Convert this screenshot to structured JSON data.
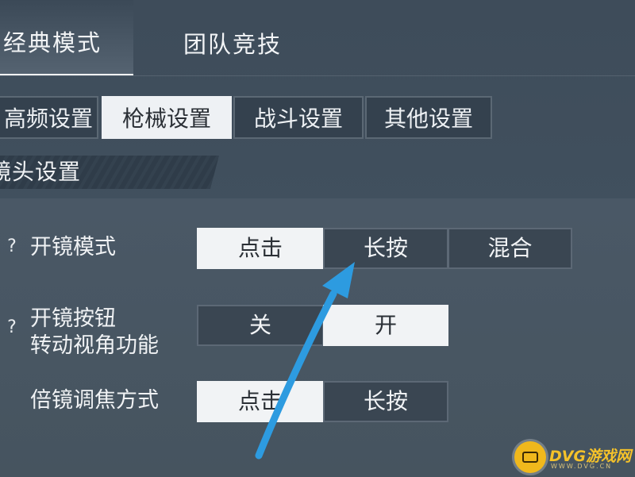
{
  "mode_tabs": [
    {
      "label": "经典模式",
      "active": true
    },
    {
      "label": "团队竞技",
      "active": false
    }
  ],
  "sub_tabs": [
    {
      "label": "高频设置",
      "active": false
    },
    {
      "label": "枪械设置",
      "active": true
    },
    {
      "label": "战斗设置",
      "active": false
    },
    {
      "label": "其他设置",
      "active": false
    }
  ],
  "section": {
    "title": "镜头设置"
  },
  "rows": [
    {
      "help": "?",
      "label": "开镜模式",
      "options": [
        {
          "label": "点击",
          "selected": true
        },
        {
          "label": "长按",
          "selected": false
        },
        {
          "label": "混合",
          "selected": false
        }
      ]
    },
    {
      "help": "?",
      "label_line1": "开镜按钮",
      "label_line2": "转动视角功能",
      "options": [
        {
          "label": "关",
          "selected": false
        },
        {
          "label": "开",
          "selected": true
        }
      ]
    },
    {
      "label": "倍镜调焦方式",
      "options": [
        {
          "label": "点击",
          "selected": true
        },
        {
          "label": "长按",
          "selected": false
        }
      ]
    }
  ],
  "annotation": {
    "arrow_color": "#2d9be0"
  },
  "watermark": {
    "text": "DVG游戏网",
    "sub": "WWW.DVG.CN"
  },
  "colors": {
    "background": "#41505e",
    "selected": "#f1f3f5",
    "unselected": "#3a4652"
  }
}
